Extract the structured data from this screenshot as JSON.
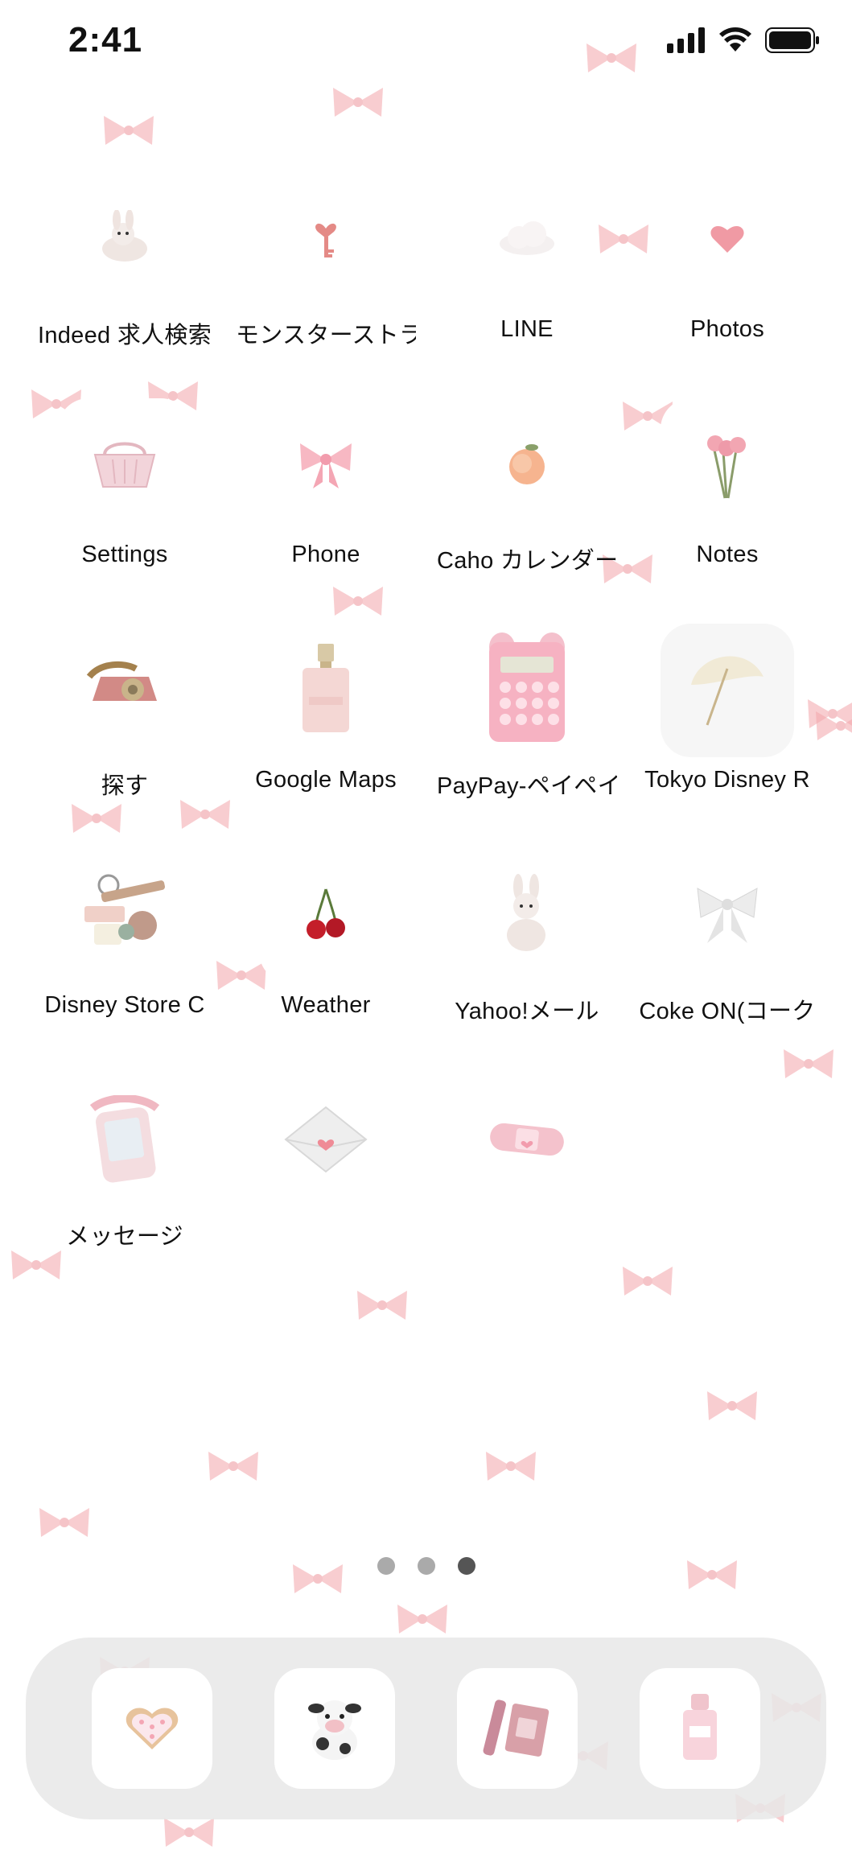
{
  "status_bar": {
    "time": "2:41",
    "icons": [
      "cellular-signal-icon",
      "wifi-icon",
      "battery-icon"
    ]
  },
  "apps": [
    {
      "label": "Indeed 求人検索",
      "icon": "bunny-plush-icon"
    },
    {
      "label": "モンスターストラ",
      "icon": "heart-key-icon"
    },
    {
      "label": "LINE",
      "icon": "cloud-icon"
    },
    {
      "label": "Photos",
      "icon": "heart-icon"
    },
    {
      "label": "Settings",
      "icon": "basket-icon"
    },
    {
      "label": "Phone",
      "icon": "pink-bow-icon"
    },
    {
      "label": "Caho カレンダー",
      "icon": "peach-icon"
    },
    {
      "label": "Notes",
      "icon": "roses-icon"
    },
    {
      "label": "探す",
      "icon": "rotary-phone-icon"
    },
    {
      "label": "Google Maps",
      "icon": "perfume-bottle-icon"
    },
    {
      "label": "PayPay-ペイペイ",
      "icon": "calculator-icon"
    },
    {
      "label": "Tokyo Disney R",
      "icon": "parasol-icon"
    },
    {
      "label": "Disney Store C",
      "icon": "makeup-icon"
    },
    {
      "label": "Weather",
      "icon": "cherries-icon"
    },
    {
      "label": "Yahoo!メール",
      "icon": "bunny-icon"
    },
    {
      "label": "Coke ON(コーク",
      "icon": "white-bow-icon"
    },
    {
      "label": "メッセージ",
      "icon": "toy-phone-icon"
    },
    {
      "label": "",
      "icon": "envelope-icon"
    },
    {
      "label": "",
      "icon": "bandage-icon"
    }
  ],
  "page_dots": {
    "count": 3,
    "active_index": 2
  },
  "dock": [
    {
      "icon": "heart-cookie-icon"
    },
    {
      "icon": "cow-plush-icon"
    },
    {
      "icon": "lip-gloss-icon"
    },
    {
      "icon": "perfume-icon"
    }
  ],
  "colors": {
    "bow_pink": "#f3a6ab",
    "accent_pink": "#f4b6bf"
  }
}
